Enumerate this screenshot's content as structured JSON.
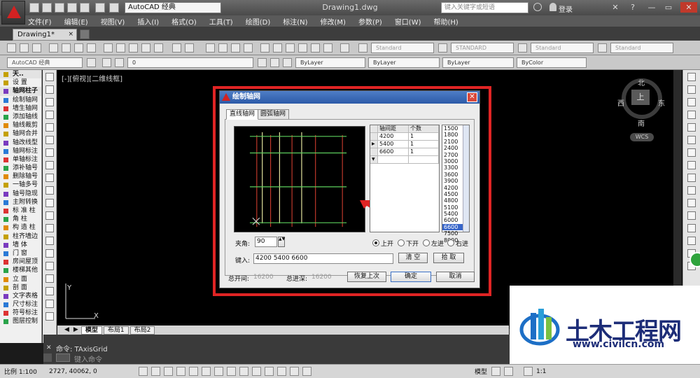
{
  "titlebar": {
    "workspace": "AutoCAD 经典",
    "doc_title": "Drawing1.dwg",
    "search_placeholder": "键入关键字或短语",
    "login": "登录"
  },
  "menus": [
    "文件(F)",
    "编辑(E)",
    "视图(V)",
    "插入(I)",
    "格式(O)",
    "工具(T)",
    "绘图(D)",
    "标注(N)",
    "修改(M)",
    "参数(P)",
    "窗口(W)",
    "帮助(H)"
  ],
  "doc_tab": {
    "label": "Drawing1*",
    "close": "×"
  },
  "toolbar2": {
    "combos": [
      "Standard",
      "STANDARD",
      "Standard",
      "Standard"
    ]
  },
  "toolbar3": {
    "workspace": "AutoCAD 经典",
    "layer": "0",
    "bylayer_1": "ByLayer",
    "bylayer_2": "ByLayer",
    "bylayer_3": "ByLayer",
    "bycolor": "ByColor"
  },
  "left_panel": {
    "header_1": "天..",
    "items": [
      {
        "label": "设    置",
        "head": false
      },
      {
        "label": "轴网柱子",
        "head": true
      },
      {
        "label": "绘制轴网",
        "head": false
      },
      {
        "label": "墙生轴网",
        "head": false
      },
      {
        "label": "添加轴线",
        "head": false
      },
      {
        "label": "轴线裁剪",
        "head": false
      },
      {
        "label": "轴网合并",
        "head": false
      },
      {
        "label": "轴改线型",
        "head": false
      },
      {
        "label": "轴网标注",
        "head": false
      },
      {
        "label": "单轴标注",
        "head": false
      },
      {
        "label": "添补轴号",
        "head": false
      },
      {
        "label": "删除轴号",
        "head": false
      },
      {
        "label": "一轴多号",
        "head": false
      },
      {
        "label": "轴号隐现",
        "head": false
      },
      {
        "label": "主附转换",
        "head": false
      },
      {
        "label": "标 准 柱",
        "head": false
      },
      {
        "label": "角    柱",
        "head": false
      },
      {
        "label": "构 造 柱",
        "head": false
      },
      {
        "label": "柱齐墙边",
        "head": false
      },
      {
        "label": "墙    体",
        "head": false
      },
      {
        "label": "门    窗",
        "head": false
      },
      {
        "label": "房间屋顶",
        "head": false
      },
      {
        "label": "楼梯其他",
        "head": false
      },
      {
        "label": "立    面",
        "head": false
      },
      {
        "label": "剖    面",
        "head": false
      },
      {
        "label": "文字表格",
        "head": false
      },
      {
        "label": "尺寸标注",
        "head": false
      },
      {
        "label": "符号标注",
        "head": false
      },
      {
        "label": "图层控制",
        "head": false
      }
    ]
  },
  "canvas": {
    "view_label": "[-][俯视][二维线框]"
  },
  "viewcube": {
    "north": "北",
    "south": "南",
    "east": "东",
    "west": "西",
    "top": "上",
    "wcs": "WCS"
  },
  "layout_tabs": [
    "模型",
    "布局1",
    "布局2"
  ],
  "command": {
    "line": "命令: TAxisGrid",
    "prompt_label": "命令:",
    "input_placeholder": "键入命令"
  },
  "status": {
    "scale": "比例 1:100",
    "coords": "2727,    40062, 0",
    "model": "模型",
    "anno_scale": "1:1"
  },
  "dialog": {
    "title": "绘制轴网",
    "close": "✕",
    "tabs": [
      "直线轴网",
      "圆弧轴网"
    ],
    "table": {
      "headers": [
        "轴间距",
        "个数"
      ],
      "rows": [
        [
          "4200",
          "1"
        ],
        [
          "5400",
          "1"
        ],
        [
          "6600",
          "1"
        ]
      ]
    },
    "values": [
      "1500",
      "1800",
      "2100",
      "2400",
      "2700",
      "3000",
      "3300",
      "3600",
      "3900",
      "4200",
      "4500",
      "4800",
      "5100",
      "5400",
      "6000",
      "6600",
      "7500",
      "8000"
    ],
    "selected_value": "6600",
    "angle_label": "夹角:",
    "angle_value": "90",
    "input_label": "键入:",
    "input_value": "4200 5400 6600",
    "radios": [
      "上开",
      "下开",
      "左进",
      "右进"
    ],
    "btn_clear": "清  空",
    "btn_pick": "拾  取",
    "total_open_label": "总开间:",
    "total_open_value": "16200",
    "total_depth_label": "总进深:",
    "total_depth_value": "16200",
    "btn_restore": "恢复上次",
    "btn_ok": "确定",
    "btn_cancel": "取消"
  },
  "watermark": {
    "title": "土木工程网",
    "url": "www.civilcn.com"
  }
}
